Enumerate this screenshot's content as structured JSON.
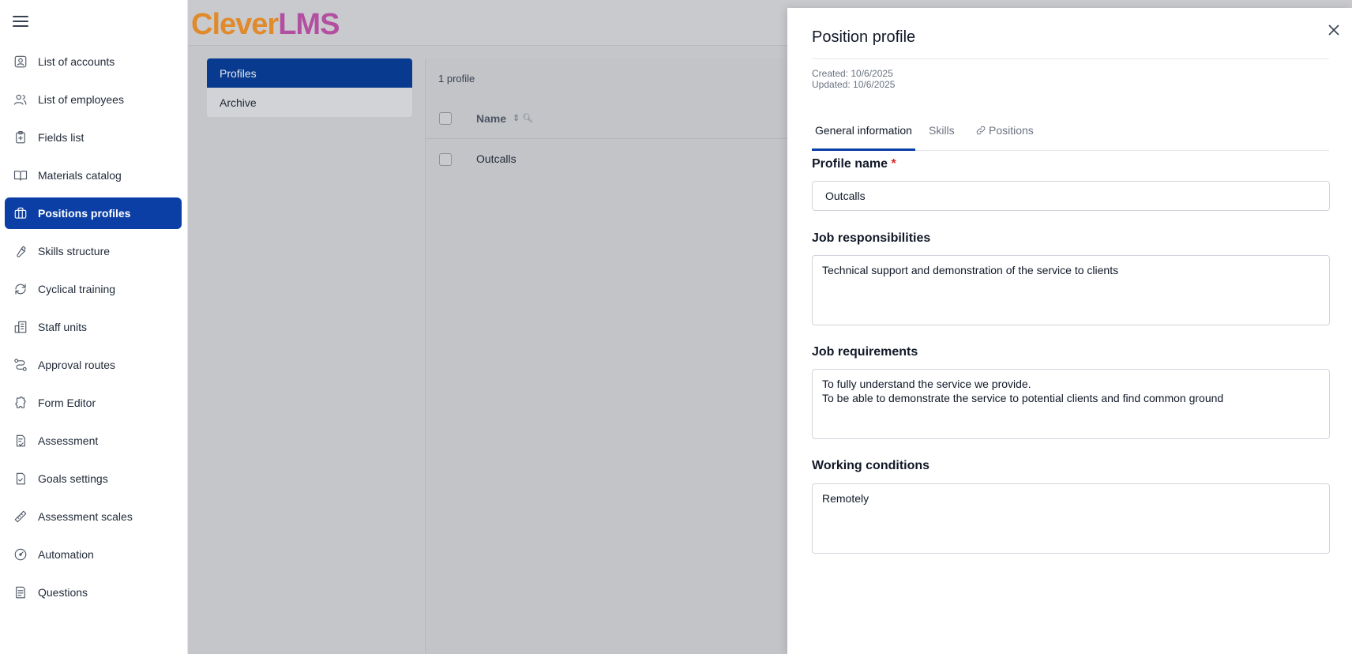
{
  "sidebar": {
    "items": [
      {
        "label": "List of accounts",
        "icon": "user-square-icon"
      },
      {
        "label": "List of employees",
        "icon": "users-icon"
      },
      {
        "label": "Fields list",
        "icon": "clipboard-plus-icon"
      },
      {
        "label": "Materials catalog",
        "icon": "book-open-icon"
      },
      {
        "label": "Positions profiles",
        "icon": "briefcase-icon",
        "active": true
      },
      {
        "label": "Skills structure",
        "icon": "wrench-icon"
      },
      {
        "label": "Cyclical training",
        "icon": "refresh-icon"
      },
      {
        "label": "Staff units",
        "icon": "building-icon"
      },
      {
        "label": "Approval routes",
        "icon": "route-icon"
      },
      {
        "label": "Form Editor",
        "icon": "puzzle-icon"
      },
      {
        "label": "Assessment",
        "icon": "file-check-icon"
      },
      {
        "label": "Goals settings",
        "icon": "file-target-icon"
      },
      {
        "label": "Assessment scales",
        "icon": "ruler-icon"
      },
      {
        "label": "Automation",
        "icon": "gauge-icon"
      },
      {
        "label": "Questions",
        "icon": "file-question-icon"
      }
    ]
  },
  "logo": {
    "part1": "Cle",
    "part2": "ver",
    "part3": "LMS"
  },
  "profiles_nav": {
    "profiles": "Profiles",
    "archive": "Archive"
  },
  "list": {
    "count": "1 profile",
    "name_header": "Name",
    "rows": [
      {
        "name": "Outcalls"
      }
    ]
  },
  "drawer": {
    "title": "Position profile",
    "created": "Created: 10/6/2025",
    "updated": "Updated: 10/6/2025",
    "tabs": [
      "General information",
      "Skills",
      "Positions"
    ],
    "profile_name_label": "Profile name",
    "required_mark": "*",
    "profile_name_value": "Outcalls",
    "responsibilities_label": "Job responsibilities",
    "responsibilities_value": "Technical support and demonstration of the service to clients",
    "requirements_label": "Job requirements",
    "requirements_value": "To fully understand the service we provide.\nTo be able to demonstrate the service to potential clients and find common ground",
    "conditions_label": "Working conditions",
    "conditions_value": "Remotely"
  },
  "colors": {
    "accent": "#0b3fa6",
    "required": "#dc2626",
    "overlay": "#c5c6ca"
  }
}
